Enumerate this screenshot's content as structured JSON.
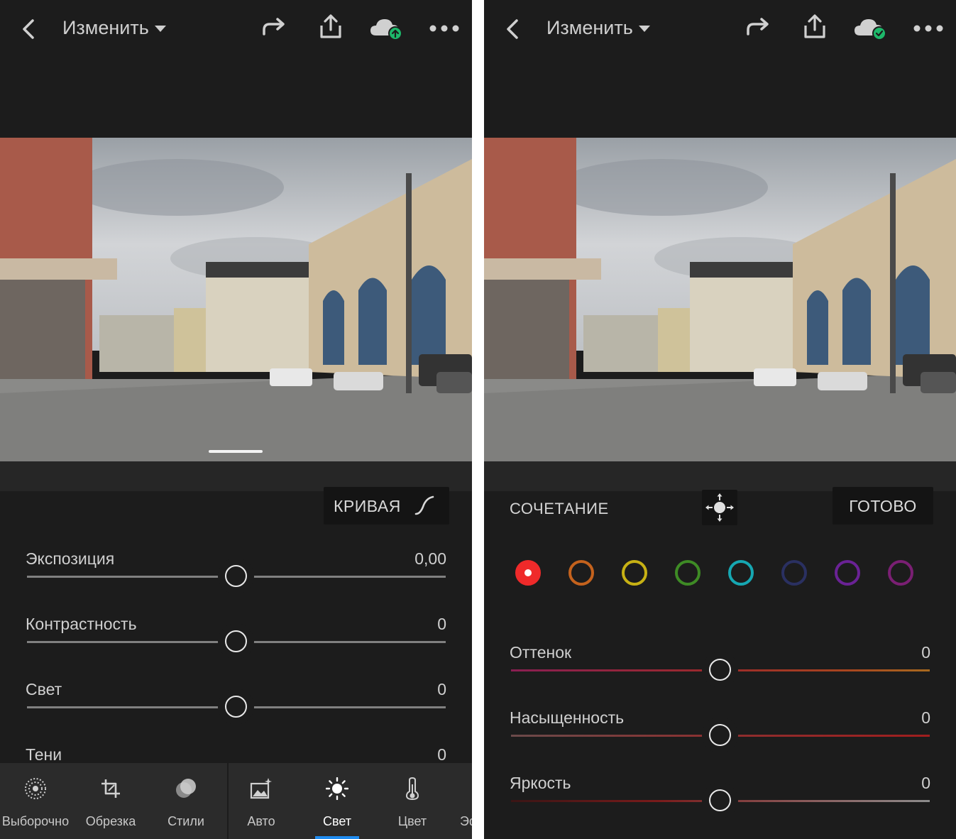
{
  "left": {
    "header": {
      "title": "Изменить"
    },
    "curve_button": "КРИВАЯ",
    "sliders": [
      {
        "name": "Экспозиция",
        "value": "0,00"
      },
      {
        "name": "Контрастность",
        "value": "0"
      },
      {
        "name": "Свет",
        "value": "0"
      },
      {
        "name": "Тени",
        "value": "0"
      }
    ],
    "tools": [
      {
        "label": "Выборочно",
        "icon": "selective-icon"
      },
      {
        "label": "Обрезка",
        "icon": "crop-icon"
      },
      {
        "label": "Стили",
        "icon": "presets-icon"
      },
      {
        "label": "Авто",
        "icon": "auto-icon"
      },
      {
        "label": "Свет",
        "icon": "light-icon",
        "active": true
      },
      {
        "label": "Цвет",
        "icon": "color-temperature-icon"
      },
      {
        "label": "Эф"
      }
    ]
  },
  "right": {
    "header": {
      "title": "Изменить"
    },
    "mix_label": "СОЧЕТАНИЕ",
    "done_button": "ГОТОВО",
    "swatches": [
      {
        "color": "#ef2a2a",
        "selected": true
      },
      {
        "color": "#c4621d"
      },
      {
        "color": "#c7b114"
      },
      {
        "color": "#3e8b25"
      },
      {
        "color": "#16a7b2"
      },
      {
        "color": "#2a3061"
      },
      {
        "color": "#6a2295"
      },
      {
        "color": "#7a1f73"
      }
    ],
    "sliders": [
      {
        "name": "Оттенок",
        "value": "0"
      },
      {
        "name": "Насыщенность",
        "value": "0"
      },
      {
        "name": "Яркость",
        "value": "0"
      }
    ]
  },
  "colors": {
    "background": "#1c1c1c",
    "toolbar": "#2b2b2b",
    "accent": "#1f8cf0",
    "cloud_badge": "#1db86a"
  }
}
